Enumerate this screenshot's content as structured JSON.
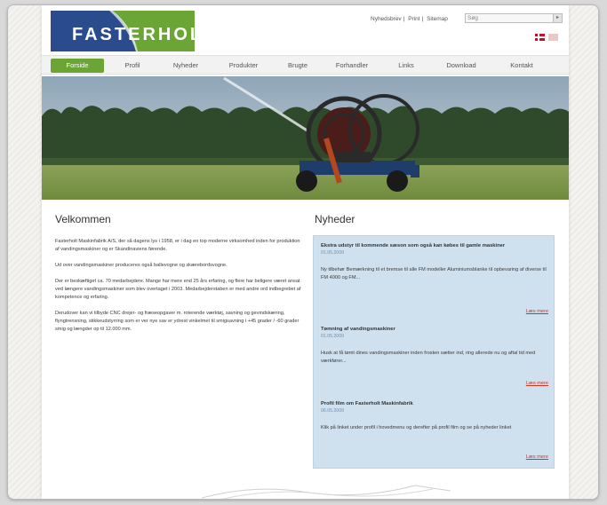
{
  "header": {
    "logo_text_left": "FASTER",
    "logo_text_right": "HOLT",
    "top_links": [
      "Nyhedsbrev",
      "Print",
      "Sitemap"
    ],
    "search_placeholder": "Søg",
    "languages": [
      "dk-flag-icon",
      "gb-flag-icon"
    ]
  },
  "nav": {
    "items": [
      "Forside",
      "Profil",
      "Nyheder",
      "Produkter",
      "Brugte",
      "Forhandler",
      "Links",
      "Download",
      "Kontakt"
    ],
    "active_index": 0
  },
  "welcome": {
    "heading": "Velkommen",
    "paragraphs": [
      "Fasterholt Maskinfabrik A/S, der så dagens lys i 1958, er i dag en top moderne virksomhed inden for produktion af vandingsmaskiner og er Skandinaviens førende.",
      "Ud over vandingsmaskiner produceres også ballevogne og skærebordsvogne.",
      "Der er beskæftiget ca. 70 medarbejdere. Mange har mere end 25 års erfaring, og flere har beligere været ansat ved længere vandingsmaskiner som blev overtaget i 2003. Medarbejderstaben er med andre ord indbegrebet af kompetence og erfaring.",
      "Derudover kan vi tilbyde CNC drejer- og fræseopgaver m. roterende værktøj, savning og gevindskæring, flyngtrensning, stikkeudstyrring som er ver nye sav er ydrest vinkelmet til smigsavning i +45 grader / -60 grader smig og længder op til 12.000 mm."
    ]
  },
  "news": {
    "heading": "Nyheder",
    "more_label": "Læs mere",
    "items": [
      {
        "title": "Ekstra udstyr til kommende sæson som også kan købes til gamle maskiner",
        "date": "01.05.2009",
        "body": "Ny tilbehør Bemærkning til et bremse til alle FM modeller Aluminiumsblanke til opbevaring af diverse til FM 4000 og FM..."
      },
      {
        "title": "Tømning af vandingsmaskiner",
        "date": "01.05.2009",
        "body": "Husk at få tømt dines vandingsmaskiner inden frosten sætter ind, ring allerede nu og aftal tid med værkfører..."
      },
      {
        "title": "Profil film om Fasterholt Maskinfabrik",
        "date": "06.05.2009",
        "body": "Klik på linket under profil i hovedmenu og derefter på profil film og se på nyheder linket"
      }
    ]
  },
  "colors": {
    "brand_blue": "#2a4b8c",
    "brand_green": "#6aa535",
    "news_bg": "#cfe1ef",
    "link_red": "#c0392b"
  }
}
